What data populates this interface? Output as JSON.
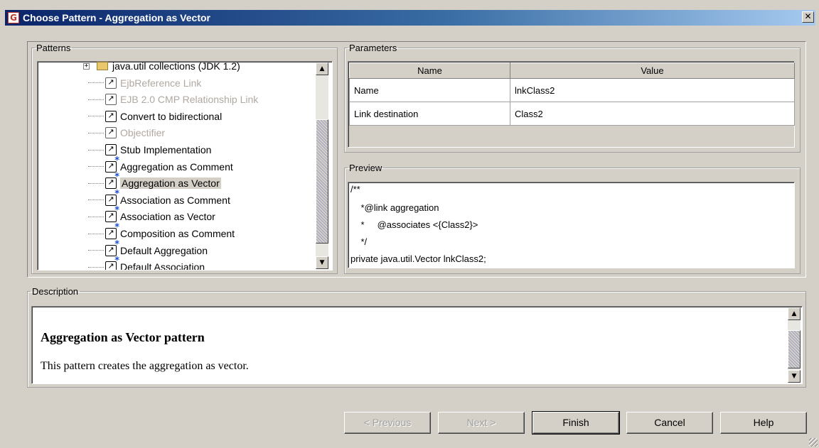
{
  "window": {
    "title": "Choose Pattern - Aggregation as Vector",
    "close_glyph": "✕"
  },
  "patterns": {
    "legend": "Patterns",
    "items": [
      {
        "label": "java.util collections (JDK 1.2)",
        "type": "folder",
        "disabled": false
      },
      {
        "label": "EjbReference Link",
        "type": "pattern",
        "disabled": true
      },
      {
        "label": "EJB 2.0  CMP Relationship Link",
        "type": "pattern",
        "disabled": true
      },
      {
        "label": "Convert to bidirectional",
        "type": "pattern",
        "disabled": false
      },
      {
        "label": "Objectifier",
        "type": "pattern",
        "disabled": true
      },
      {
        "label": "Stub Implementation",
        "type": "pattern",
        "disabled": false
      },
      {
        "label": "Aggregation as Comment",
        "type": "pattern-star",
        "disabled": false
      },
      {
        "label": "Aggregation as Vector",
        "type": "pattern-star",
        "disabled": false,
        "selected": true
      },
      {
        "label": "Association as Comment",
        "type": "pattern-star",
        "disabled": false
      },
      {
        "label": "Association as Vector",
        "type": "pattern-star",
        "disabled": false
      },
      {
        "label": "Composition as Comment",
        "type": "pattern-star",
        "disabled": false
      },
      {
        "label": "Default Aggregation",
        "type": "pattern-star",
        "disabled": false
      },
      {
        "label": "Default Association",
        "type": "pattern-star",
        "disabled": false
      }
    ]
  },
  "parameters": {
    "legend": "Parameters",
    "columns": [
      "Name",
      "Value"
    ],
    "rows": [
      {
        "name": "Name",
        "value": "lnkClass2"
      },
      {
        "name": "Link destination",
        "value": "Class2"
      }
    ]
  },
  "preview": {
    "legend": "Preview",
    "lines": [
      "/**",
      "    *@link aggregation",
      "    *     @associates <{Class2}>",
      "    */",
      "private java.util.Vector lnkClass2;"
    ]
  },
  "description": {
    "legend": "Description",
    "title": "Aggregation as Vector pattern",
    "body": "This pattern creates the aggregation as vector."
  },
  "buttons": {
    "previous": "< Previous",
    "next": "Next >",
    "finish": "Finish",
    "cancel": "Cancel",
    "help": "Help"
  },
  "icons": {
    "pattern": "pattern-arrow-icon",
    "pattern_star": "pattern-arrow-star-icon",
    "folder": "folder-icon"
  }
}
